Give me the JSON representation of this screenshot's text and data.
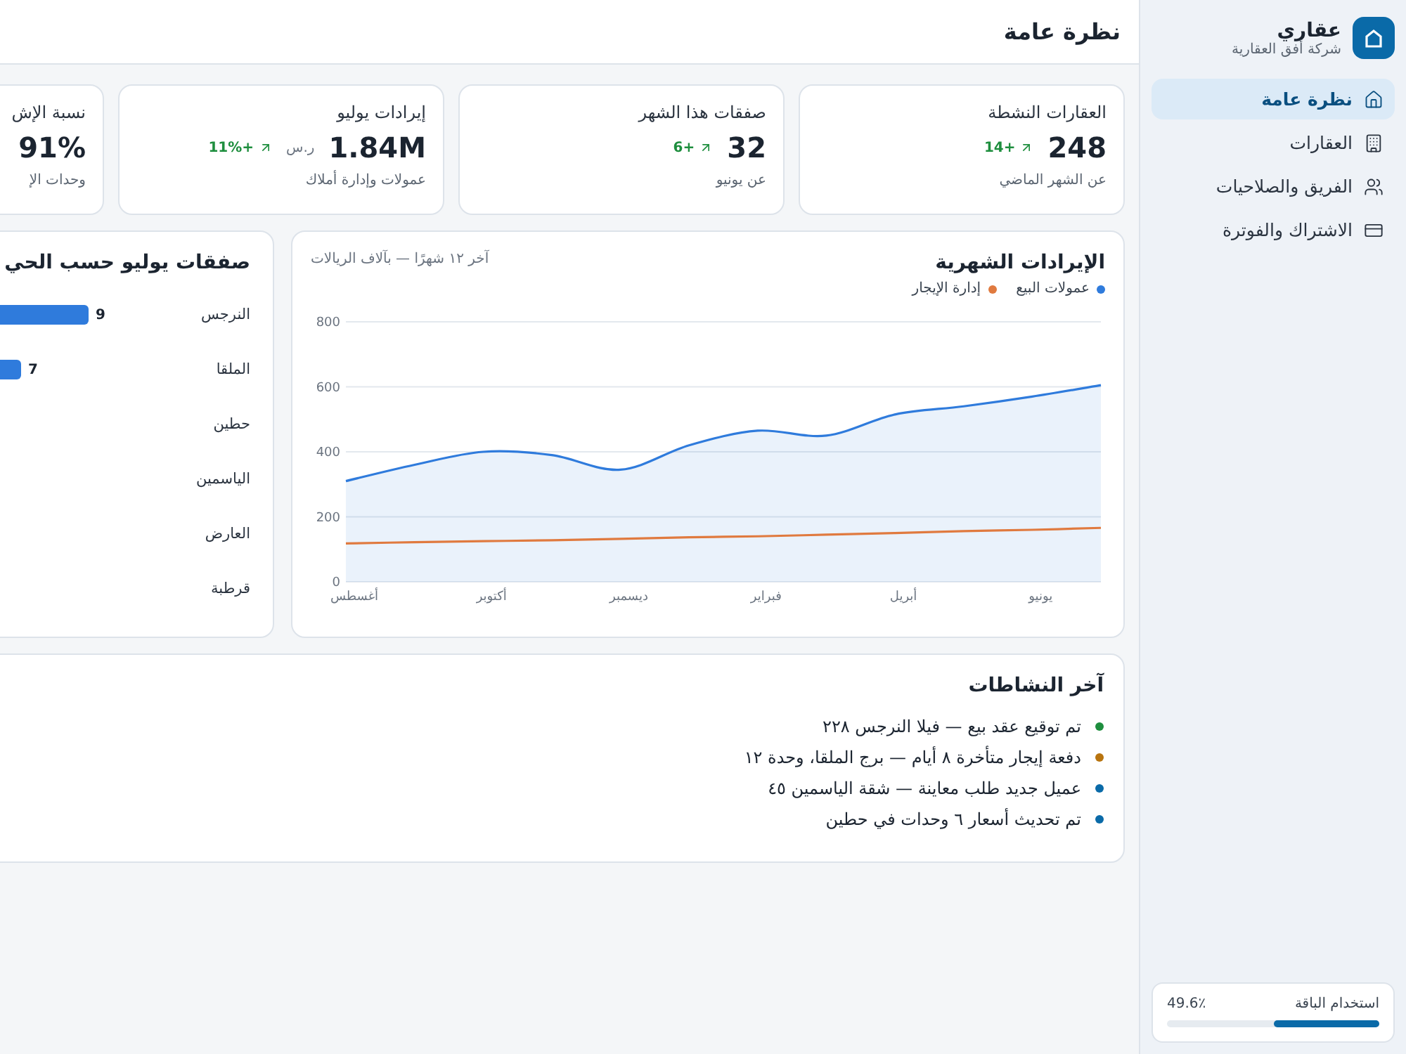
{
  "sidebar": {
    "brand": {
      "name": "عقاري",
      "company": "شركة أفق العقارية"
    },
    "items": [
      {
        "label": "نظرة عامة",
        "selected": true
      },
      {
        "label": "العقارات",
        "selected": false
      },
      {
        "label": "الفريق والصلاحيات",
        "selected": false
      },
      {
        "label": "الاشتراك والفوترة",
        "selected": false
      }
    ],
    "plan": {
      "label": "استخدام الباقة",
      "reading": "49.6٪",
      "level": 0.496
    }
  },
  "header": {
    "title": "نظرة عامة"
  },
  "stats": [
    {
      "title": "العقارات النشطة",
      "value": "248",
      "delta": "+14",
      "note": "عن الشهر الماضي"
    },
    {
      "title": "صفقات هذا الشهر",
      "value": "32",
      "delta": "+6",
      "note": "عن يونيو"
    },
    {
      "title": "إيرادات يوليو",
      "value": "1.84M",
      "unit": "ر.س",
      "delta": "+11%",
      "note": "عمولات وإدارة أملاك"
    },
    {
      "title": "نسبة الإش",
      "value": "91%",
      "note": "وحدات الإ"
    }
  ],
  "revenue": {
    "title": "الإيرادات الشهرية",
    "subtitle": "آخر ١٢ شهرًا — بآلاف الريالات",
    "chart_data": {
      "type": "line",
      "categories": [
        "أغسطس",
        null,
        "أكتوبر",
        null,
        "ديسمبر",
        null,
        "فبراير",
        null,
        "أبريل",
        null,
        "يونيو",
        null
      ],
      "series": [
        {
          "name": "عمولات البيع",
          "type": "area",
          "color": "#2f7bdc",
          "values": [
            310,
            360,
            400,
            390,
            345,
            420,
            465,
            450,
            515,
            540,
            570,
            605
          ]
        },
        {
          "name": "إدارة الإيجار",
          "type": "line",
          "color": "#e07a3f",
          "values": [
            118,
            122,
            125,
            128,
            132,
            137,
            140,
            145,
            150,
            156,
            160,
            166
          ]
        }
      ],
      "grid": true,
      "ylim": [
        0,
        800
      ],
      "yticks": [
        0,
        200,
        400,
        600,
        800
      ]
    }
  },
  "districts": {
    "title": "صفقات يوليو حسب الحي",
    "rows": [
      {
        "name": "النرجس",
        "value": "9"
      },
      {
        "name": "الملقا",
        "value": "7"
      },
      {
        "name": "حطين"
      },
      {
        "name": "الياسمين"
      },
      {
        "name": "العارض"
      },
      {
        "name": "قرطبة"
      }
    ]
  },
  "activity": {
    "title": "آخر النشاطات",
    "items": [
      {
        "text": "تم توقيع عقد بيع — فيلا النرجس ٢٢٨",
        "color": "#1e8e3e"
      },
      {
        "text": "دفعة إيجار متأخرة ٨ أيام — برج الملقا، وحدة ١٢",
        "color": "#b8740f"
      },
      {
        "text": "عميل جديد طلب معاينة — شقة الياسمين ٤٥",
        "color": "#0a6aa8"
      },
      {
        "text": "تم تحديث أسعار ٦ وحدات في حطين",
        "color": "#0a6aa8"
      }
    ]
  }
}
